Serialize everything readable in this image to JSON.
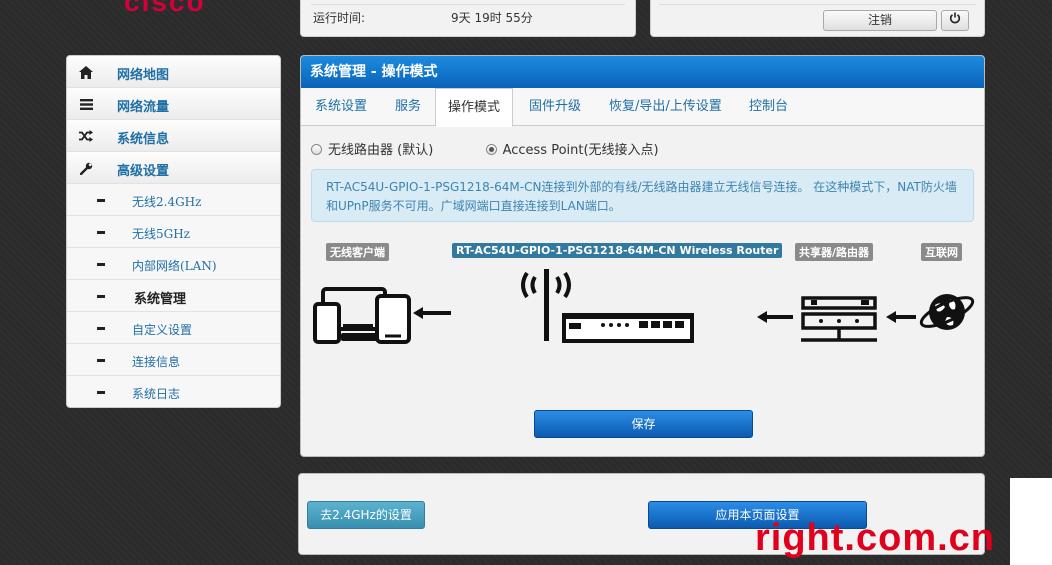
{
  "brand": {
    "logo_text": "cisco"
  },
  "status": {
    "uptime_label": "运行时间:",
    "uptime_value": "9天 19时 55分"
  },
  "header": {
    "logout_label": "注销",
    "power_icon": "power-icon"
  },
  "sidebar": {
    "items": [
      {
        "label": "网络地图",
        "icon": "home-icon"
      },
      {
        "label": "网络流量",
        "icon": "list-icon"
      },
      {
        "label": "系统信息",
        "icon": "shuffle-icon"
      },
      {
        "label": "高级设置",
        "icon": "wrench-icon"
      }
    ],
    "subitems": [
      {
        "label": "无线2.4GHz"
      },
      {
        "label": "无线5GHz"
      },
      {
        "label": "内部网络(LAN)"
      },
      {
        "label": "系统管理",
        "active": true
      },
      {
        "label": "自定义设置"
      },
      {
        "label": "连接信息"
      },
      {
        "label": "系统日志"
      }
    ]
  },
  "panel": {
    "title": "系统管理 - 操作模式",
    "tabs": [
      "系统设置",
      "服务",
      "操作模式",
      "固件升级",
      "恢复/导出/上传设置",
      "控制台"
    ],
    "active_tab": "操作模式",
    "modes": [
      {
        "label": "无线路由器 (默认)",
        "selected": false
      },
      {
        "label": "Access Point(无线接入点)",
        "selected": true
      }
    ],
    "info_text": "RT-AC54U-GPIO-1-PSG1218-64M-CN连接到外部的有线/无线路由器建立无线信号连接。 在这种模式下，NAT防火墙和UPnP服务不可用。广域网端口直接连接到LAN端口。",
    "diagram": {
      "clients_label": "无线客户端",
      "router_label": "RT-AC54U-GPIO-1-PSG1218-64M-CN Wireless Router",
      "shared_label": "共享器/路由器",
      "internet_label": "互联网"
    },
    "save_label": "保存"
  },
  "footer": {
    "goto_24_label": "去2.4GHz的设置",
    "apply_label": "应用本页面设置"
  },
  "watermark": "right.com.cn",
  "colors": {
    "title_bar": "#0a63b8",
    "link": "#1f6fa6",
    "info_bg": "#d9ebf5",
    "watermark": "#e0001b",
    "logo": "#d3003b"
  }
}
